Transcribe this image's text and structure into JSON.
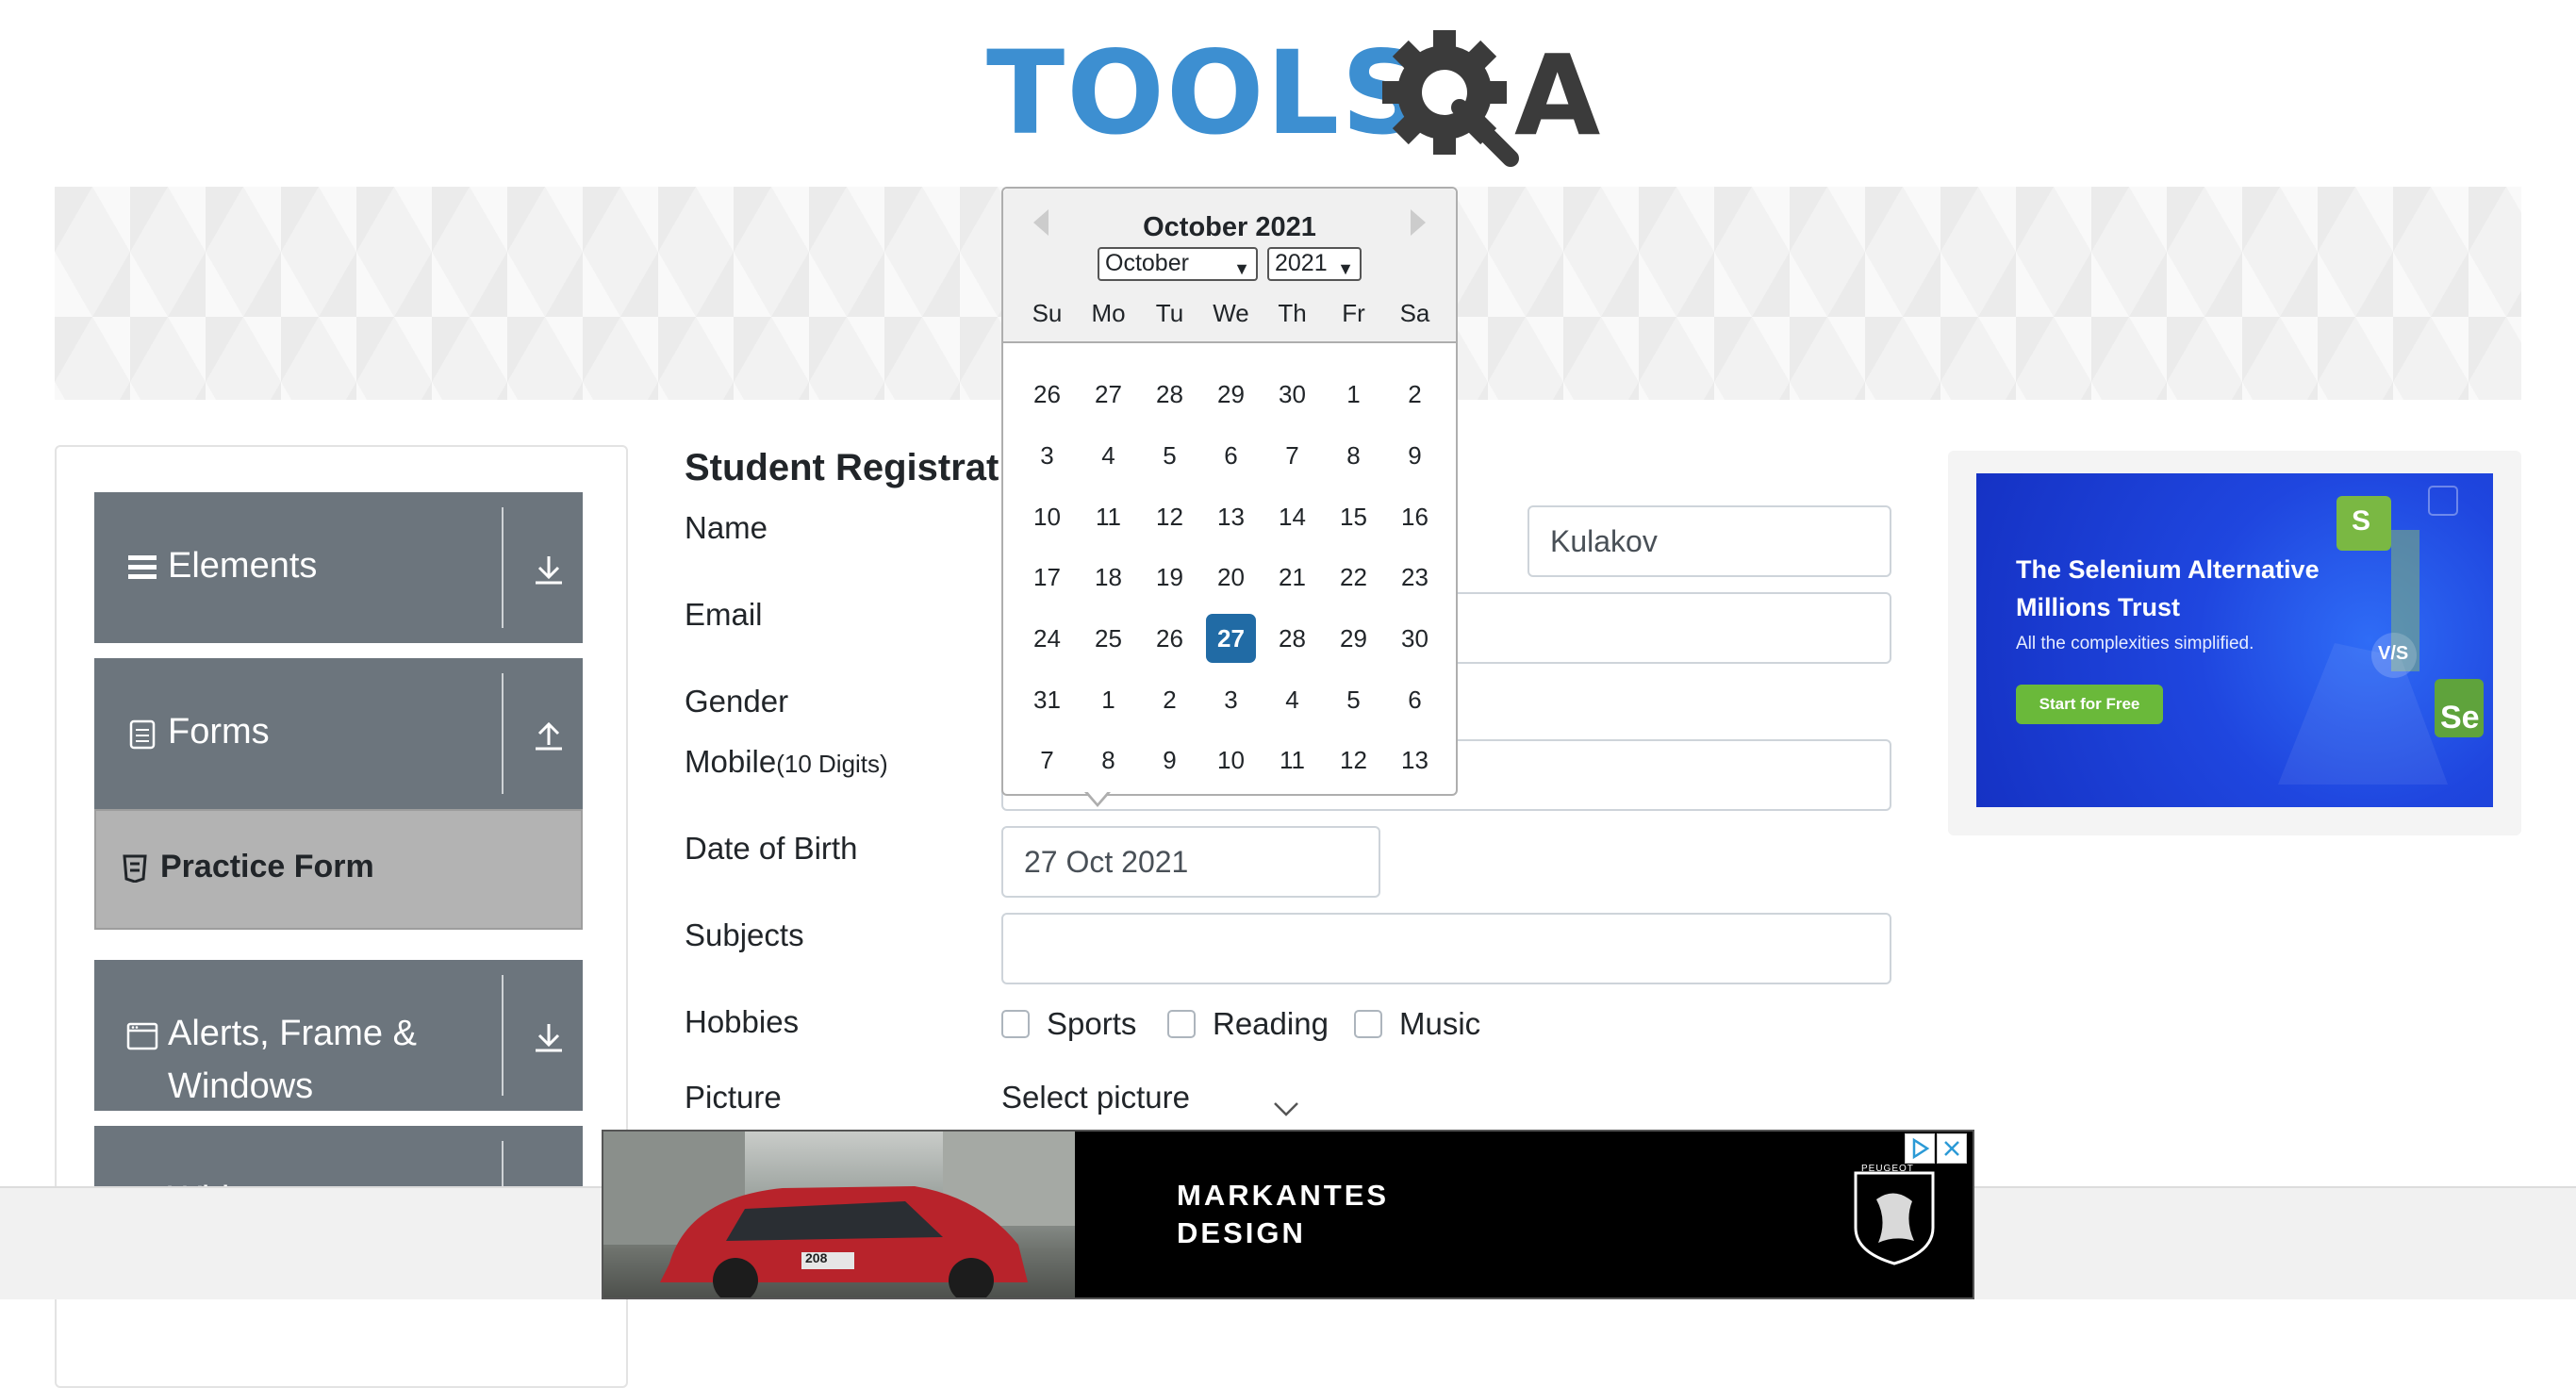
{
  "header": {
    "logo_text_tools": "TOOLS",
    "logo_text_a": "A"
  },
  "banner": {
    "title": "Practice Form"
  },
  "sidebar": {
    "groups": [
      {
        "label": "Elements",
        "icon": "hamburger-icon",
        "arrow": "download-arrow-icon"
      },
      {
        "label": "Forms",
        "icon": "document-icon",
        "arrow": "upload-arrow-icon"
      },
      {
        "label": "Alerts, Frame &",
        "label2": "Windows",
        "icon": "window-icon",
        "arrow": "download-arrow-icon"
      },
      {
        "label": "Widgets"
      }
    ],
    "active_item": {
      "label": "Practice Form",
      "icon": "html5-icon"
    }
  },
  "form": {
    "title": "Student Registration Form",
    "labels": {
      "name": "Name",
      "email": "Email",
      "gender": "Gender",
      "mobile": "Mobile",
      "mobile_hint": "(10 Digits)",
      "dob": "Date of Birth",
      "subjects": "Subjects",
      "hobbies": "Hobbies",
      "picture": "Picture"
    },
    "last_name_value": "Kulakov",
    "dob_value": "27 Oct 2021",
    "hobbies": [
      "Sports",
      "Reading",
      "Music"
    ],
    "picture_label": "Select picture"
  },
  "datepicker": {
    "title": "October 2021",
    "month_select": "October",
    "year_select": "2021",
    "day_names": [
      "Su",
      "Mo",
      "Tu",
      "We",
      "Th",
      "Fr",
      "Sa"
    ],
    "weeks": [
      [
        "26",
        "27",
        "28",
        "29",
        "30",
        "1",
        "2"
      ],
      [
        "3",
        "4",
        "5",
        "6",
        "7",
        "8",
        "9"
      ],
      [
        "10",
        "11",
        "12",
        "13",
        "14",
        "15",
        "16"
      ],
      [
        "17",
        "18",
        "19",
        "20",
        "21",
        "22",
        "23"
      ],
      [
        "24",
        "25",
        "26",
        "27",
        "28",
        "29",
        "30"
      ],
      [
        "31",
        "1",
        "2",
        "3",
        "4",
        "5",
        "6"
      ],
      [
        "7",
        "8",
        "9",
        "10",
        "11",
        "12",
        "13"
      ]
    ],
    "selected": "27"
  },
  "right_ad": {
    "headline": "The Selenium Alternative Millions Trust",
    "sub": "All the complexities simplified.",
    "cta": "Start for Free",
    "badge_s": "S",
    "badge_vs": "V/S",
    "badge_se": "Se"
  },
  "bottom_ad": {
    "tagline_line1": "MARKANTES",
    "tagline_line2": "DESIGN",
    "brand": "PEUGEOT",
    "plate": "208"
  }
}
